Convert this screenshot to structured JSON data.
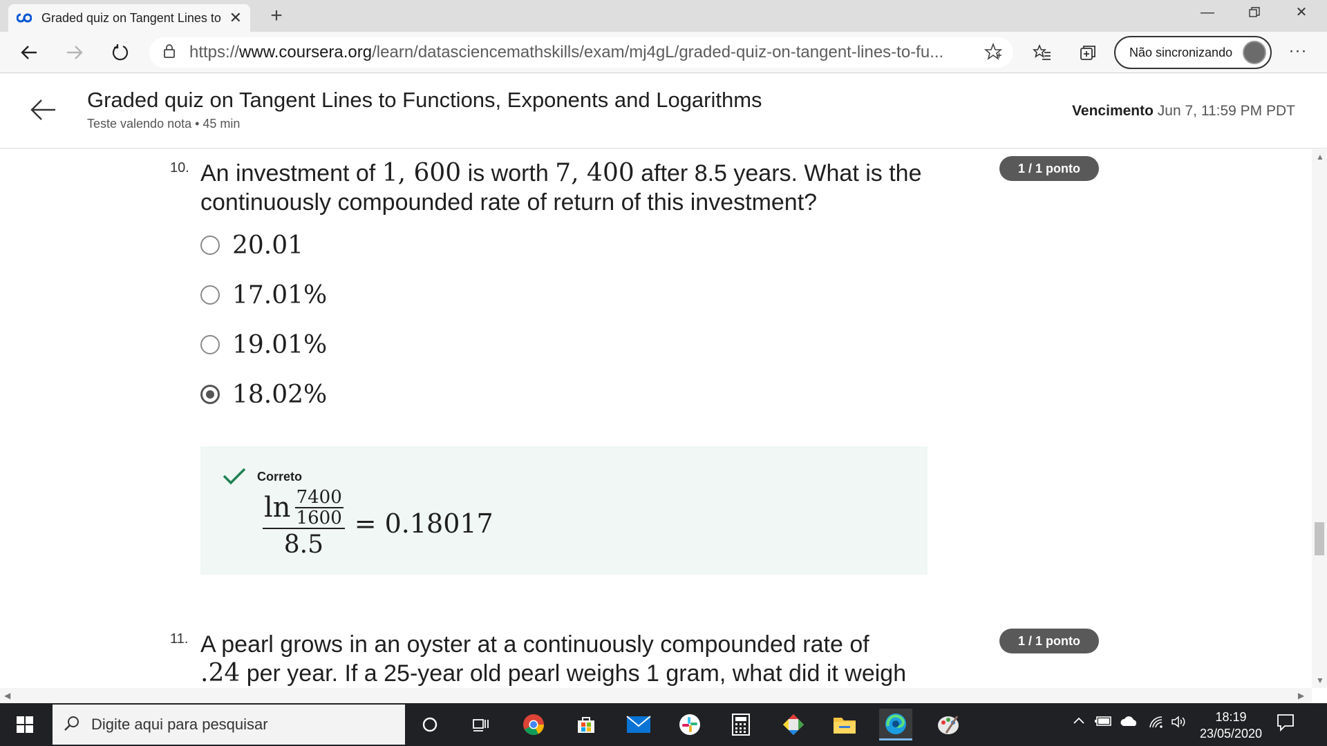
{
  "browser": {
    "tab_title": "Graded quiz on Tangent Lines to Functions, Exponents and Logarithms | Coursera",
    "url_prefix": "https://",
    "url_host": "www.coursera.org",
    "url_path": "/learn/datasciencemathskills/exam/mj4gL/graded-quiz-on-tangent-lines-to-fu...",
    "sync_label": "Não sincronizando",
    "more_label": "···"
  },
  "header": {
    "title": "Graded quiz on Tangent Lines to Functions, Exponents and Logarithms",
    "subtitle": "Teste valendo nota • 45 min",
    "due_label": "Vencimento",
    "due_value": "Jun 7, 11:59 PM PDT"
  },
  "questions": [
    {
      "number": "10.",
      "text_a": "An investment of ",
      "math_a": "1, 600",
      "text_b": " is worth ",
      "math_b": "7, 400",
      "text_c": " after 8.5 years. What is the continuously compounded rate of return of this investment?",
      "score": "1 / 1 ponto",
      "options": [
        "20.01",
        "17.01%",
        "19.01%",
        "18.02%"
      ],
      "selected_index": 3,
      "feedback": {
        "label": "Correto",
        "ln": "ln",
        "num_top": "7400",
        "num_bottom": "1600",
        "denominator": "8.5",
        "equals": "=",
        "result": "0.18017"
      }
    },
    {
      "number": "11.",
      "text_line1": "A pearl grows in an oyster at a continuously compounded rate of",
      "math_a": ".24",
      "text_line2": " per year. If a 25-year old pearl weighs 1 gram, what did it weigh",
      "score": "1 / 1 ponto"
    }
  ],
  "taskbar": {
    "search_placeholder": "Digite aqui para pesquisar",
    "time": "18:19",
    "date": "23/05/2020"
  }
}
